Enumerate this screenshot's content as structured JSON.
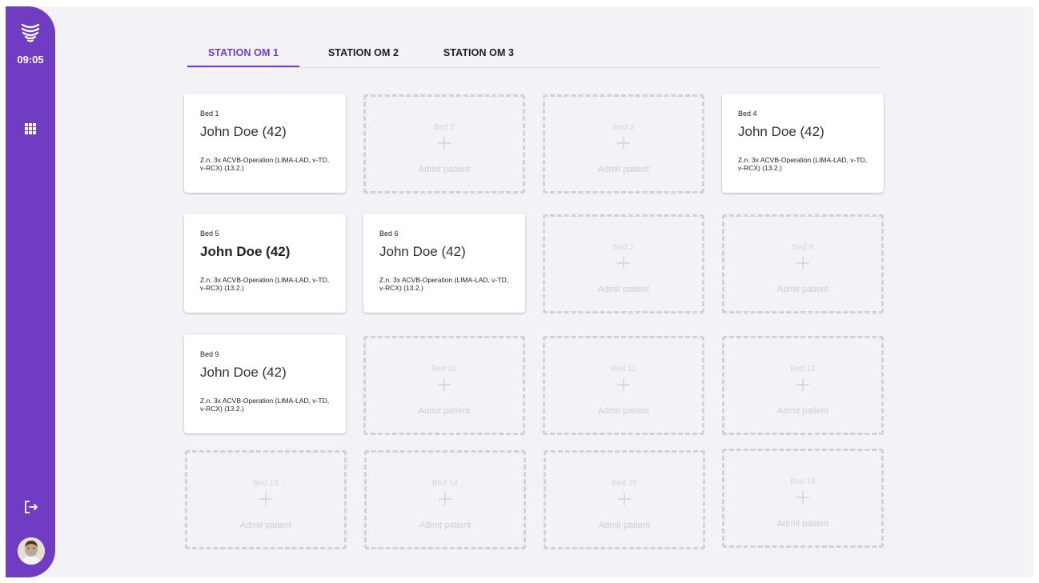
{
  "sidebar": {
    "time": "09:05",
    "logo_icon": "wave-logo-icon",
    "apps_icon": "grid-apps-icon",
    "logout_icon": "logout-icon",
    "accent_color": "#6f3cc2"
  },
  "tabs": [
    {
      "label": "STATION OM 1",
      "active": true
    },
    {
      "label": "STATION OM 2",
      "active": false
    },
    {
      "label": "STATION OM 3",
      "active": false
    }
  ],
  "beds": [
    {
      "bed": "Bed 1",
      "name": "John Doe (42)",
      "diagnosis": "Z.n. 3x ACVB-Operation (LIMA-LAD, v-TD, v-RCX) (13.2.)"
    },
    {
      "bed": "Bed 2",
      "admit": "Admit patient"
    },
    {
      "bed": "Bed 3",
      "admit": "Admit patient"
    },
    {
      "bed": "Bed 4",
      "name": "John Doe (42)",
      "diagnosis": "Z.n. 3x ACVB-Operation (LIMA-LAD, v-TD, v-RCX) (13.2.)"
    },
    {
      "bed": "Bed 5",
      "name": "John Doe (42)",
      "diagnosis": "Z.n. 3x ACVB-Operation (LIMA-LAD, v-TD, v-RCX) (13.2.)"
    },
    {
      "bed": "Bed 6",
      "name": "John Doe (42)",
      "diagnosis": "Z.n. 3x ACVB-Operation (LIMA-LAD, v-TD, v-RCX) (13.2.)"
    },
    {
      "bed": "Bed 7",
      "admit": "Admit patient"
    },
    {
      "bed": "Bed 8",
      "admit": "Admit patient"
    },
    {
      "bed": "Bed 9",
      "name": "John Doe (42)",
      "diagnosis": "Z.n. 3x ACVB-Operation (LIMA-LAD, v-TD, v-RCX) (13.2.)"
    },
    {
      "bed": "Bed 10",
      "admit": "Admit patient"
    },
    {
      "bed": "Bed 11",
      "admit": "Admit patient"
    },
    {
      "bed": "Bed 12",
      "admit": "Admit patient"
    },
    {
      "bed": "Bed 13",
      "admit": "Admit patient"
    },
    {
      "bed": "Bed 14",
      "admit": "Admit patient"
    },
    {
      "bed": "Bed 15",
      "admit": "Admit patient"
    },
    {
      "bed": "Bed 16",
      "admit": "Admit patient"
    }
  ]
}
